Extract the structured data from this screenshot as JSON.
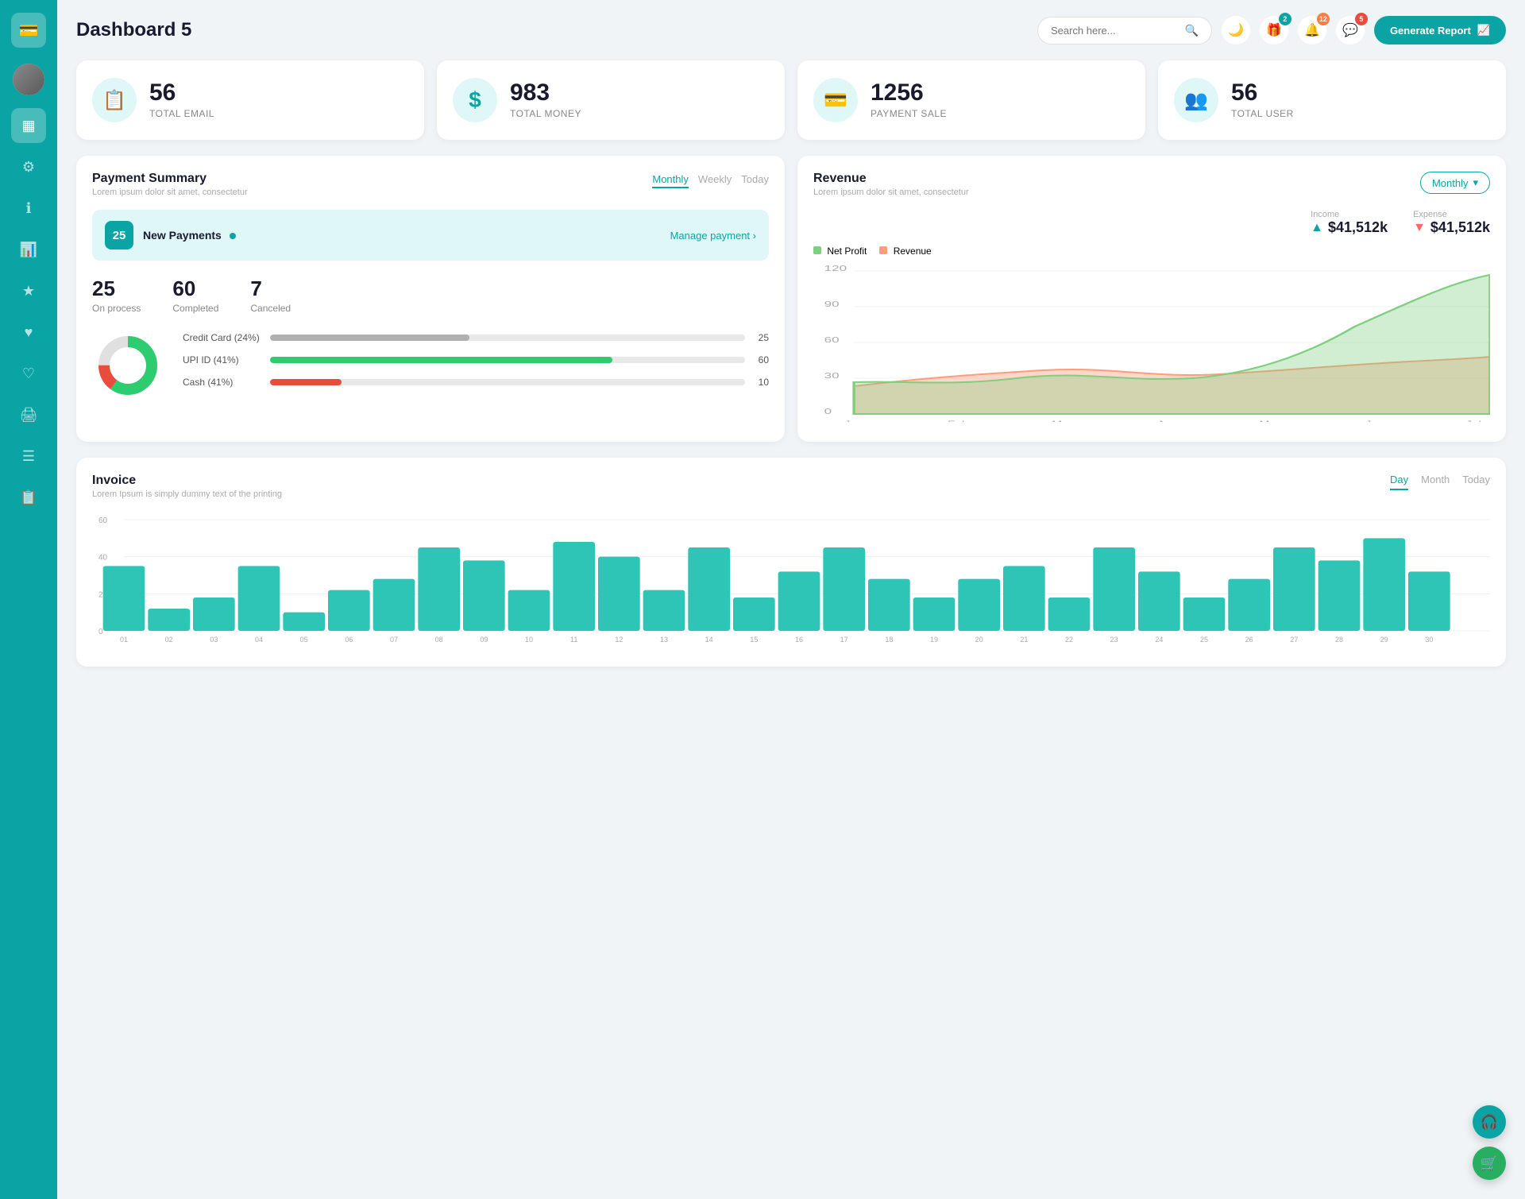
{
  "sidebar": {
    "logo_icon": "💳",
    "items": [
      {
        "id": "dashboard",
        "icon": "▦",
        "active": true
      },
      {
        "id": "settings",
        "icon": "⚙"
      },
      {
        "id": "info",
        "icon": "ℹ"
      },
      {
        "id": "chart",
        "icon": "📊"
      },
      {
        "id": "star",
        "icon": "★"
      },
      {
        "id": "heart",
        "icon": "♥"
      },
      {
        "id": "heart2",
        "icon": "♡"
      },
      {
        "id": "print",
        "icon": "🖨"
      },
      {
        "id": "list",
        "icon": "☰"
      },
      {
        "id": "clipboard",
        "icon": "📋"
      }
    ]
  },
  "header": {
    "title": "Dashboard 5",
    "search_placeholder": "Search here...",
    "generate_btn": "Generate Report",
    "notif_counts": {
      "gift": 2,
      "bell": 12,
      "chat": 5
    }
  },
  "stats": [
    {
      "id": "total-email",
      "icon": "📋",
      "value": "56",
      "label": "TOTAL EMAIL"
    },
    {
      "id": "total-money",
      "icon": "$",
      "value": "983",
      "label": "TOTAL MONEY"
    },
    {
      "id": "payment-sale",
      "icon": "💳",
      "value": "1256",
      "label": "PAYMENT SALE"
    },
    {
      "id": "total-user",
      "icon": "👥",
      "value": "56",
      "label": "TOTAL USER"
    }
  ],
  "payment_summary": {
    "title": "Payment Summary",
    "subtitle": "Lorem ipsum dolor sit amet, consectetur",
    "tabs": [
      "Monthly",
      "Weekly",
      "Today"
    ],
    "active_tab": "Monthly",
    "new_payments_count": "25",
    "new_payments_label": "New Payments",
    "manage_link": "Manage payment",
    "metrics": [
      {
        "value": "25",
        "label": "On process"
      },
      {
        "value": "60",
        "label": "Completed"
      },
      {
        "value": "7",
        "label": "Canceled"
      }
    ],
    "bars": [
      {
        "label": "Credit Card (24%)",
        "fill_pct": 42,
        "color": "#b0b0b0",
        "value": "25"
      },
      {
        "label": "UPI ID (41%)",
        "fill_pct": 72,
        "color": "#2ecc71",
        "value": "60"
      },
      {
        "label": "Cash (41%)",
        "fill_pct": 15,
        "color": "#e74c3c",
        "value": "10"
      }
    ],
    "donut": {
      "segments": [
        {
          "color": "#2ecc71",
          "pct": 60
        },
        {
          "color": "#e74c3c",
          "pct": 15
        },
        {
          "color": "#e0e0e0",
          "pct": 25
        }
      ]
    }
  },
  "revenue": {
    "title": "Revenue",
    "subtitle": "Lorem ipsum dolor sit amet, consectetur",
    "tab_label": "Monthly",
    "income_label": "Income",
    "income_value": "$41,512k",
    "expense_label": "Expense",
    "expense_value": "$41,512k",
    "legend": [
      {
        "label": "Net Profit",
        "color": "#7ecf7e"
      },
      {
        "label": "Revenue",
        "color": "#ff9c7a"
      }
    ],
    "chart_months": [
      "Jan",
      "Feb",
      "Mar",
      "Apr",
      "May",
      "Jun",
      "July"
    ],
    "chart_y_labels": [
      "0",
      "30",
      "60",
      "90",
      "120"
    ]
  },
  "invoice": {
    "title": "Invoice",
    "subtitle": "Lorem Ipsum is simply dummy text of the printing",
    "tabs": [
      "Day",
      "Month",
      "Today"
    ],
    "active_tab": "Day",
    "y_labels": [
      "0",
      "20",
      "40",
      "60"
    ],
    "x_labels": [
      "01",
      "02",
      "03",
      "04",
      "05",
      "06",
      "07",
      "08",
      "09",
      "10",
      "11",
      "12",
      "13",
      "14",
      "15",
      "16",
      "17",
      "18",
      "19",
      "20",
      "21",
      "22",
      "23",
      "24",
      "25",
      "26",
      "27",
      "28",
      "29",
      "30"
    ],
    "bars": [
      35,
      12,
      18,
      35,
      10,
      22,
      28,
      45,
      38,
      22,
      48,
      40,
      22,
      45,
      18,
      32,
      45,
      28,
      18,
      28,
      35,
      18,
      45,
      32,
      18,
      28,
      45,
      38,
      50,
      32
    ]
  },
  "floating": {
    "support_icon": "🎧",
    "cart_icon": "🛒"
  }
}
